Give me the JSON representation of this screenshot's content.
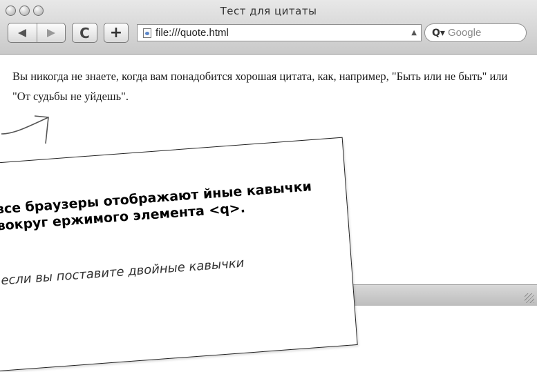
{
  "window": {
    "title": "Тест для цитаты"
  },
  "toolbar": {
    "back_icon": "back-arrow-icon",
    "forward_icon": "forward-arrow-icon",
    "reload_label": "C",
    "add_label": "+",
    "url": "file:///quote.html",
    "search_placeholder": "Google"
  },
  "page": {
    "body_text": "Вы никогда не знаете, когда вам понадобится хорошая цитата, как, например, \"Быть или не быть\" или \"От судьбы не уйдешь\"."
  },
  "note": {
    "heading": "все браузеры отображают йные кавычки вокруг ержимого элемента <q>.",
    "body": "если вы поставите двойные кавычки"
  }
}
